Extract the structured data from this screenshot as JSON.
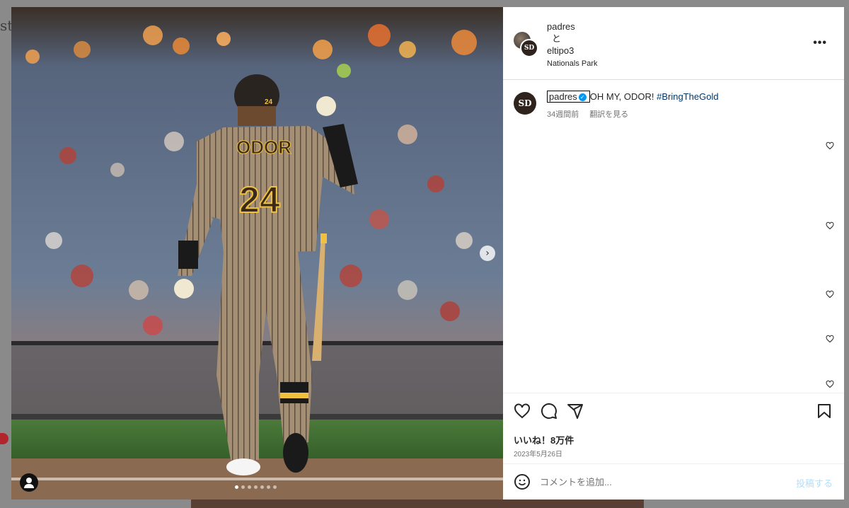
{
  "background": {
    "logo_fragment": "st"
  },
  "header": {
    "user1": "padres",
    "conjunction": "と",
    "user2": "eltipo3",
    "location": "Nationals Park",
    "more_icon": "more-horizontal-icon",
    "avatar_monogram": "SD"
  },
  "caption": {
    "username": "padres",
    "verified_icon": "verified-badge-icon",
    "text": "OH MY, ODOR!",
    "hashtag": "#BringTheGold",
    "time_ago": "34週間前",
    "translate": "翻訳を見る",
    "avatar_monogram": "SD"
  },
  "photo": {
    "jersey_name": "ODOR",
    "jersey_number": "24",
    "helmet_number": "24",
    "next_icon": "chevron-right-icon",
    "carousel_count": 7,
    "carousel_active": 0
  },
  "actions": {
    "like_icon": "heart-icon",
    "comment_icon": "comment-icon",
    "share_icon": "send-icon",
    "save_icon": "bookmark-icon"
  },
  "likes": "いいね！8万件",
  "date": "2023年5月26日",
  "comment": {
    "placeholder": "コメントを追加...",
    "post_label": "投稿する",
    "emoji_icon": "emoji-icon"
  },
  "colors": {
    "verified": "#0095f6",
    "hashtag": "#00376b",
    "post_disabled": "#b2dffc",
    "padres_brown": "#2f241d"
  }
}
